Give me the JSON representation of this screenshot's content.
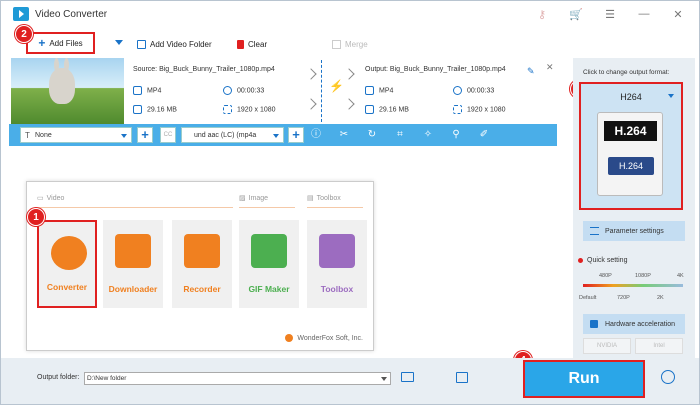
{
  "app": {
    "title": "Video Converter"
  },
  "toolbar": {
    "add_files": "Add Files",
    "add_folder": "Add Video Folder",
    "clear": "Clear",
    "merge": "Merge"
  },
  "file": {
    "source": "Source: Big_Buck_Bunny_Trailer_1080p.mp4",
    "output": "Output: Big_Buck_Bunny_Trailer_1080p.mp4",
    "src_format": "MP4",
    "src_duration": "00:00:33",
    "src_size": "29.16 MB",
    "src_res": "1920 x 1080",
    "out_format": "MP4",
    "out_duration": "00:00:33",
    "out_size": "29.16 MB",
    "out_res": "1920 x 1080"
  },
  "editbar": {
    "subtitle": "None",
    "audio": "und aac (LC) (mp4a",
    "cc": "CC"
  },
  "hub": {
    "sections": {
      "video": "Video",
      "image": "Image",
      "toolbox": "Toolbox"
    },
    "tiles": [
      {
        "label": "Converter",
        "color": "#f08020"
      },
      {
        "label": "Downloader",
        "color": "#f08020"
      },
      {
        "label": "Recorder",
        "color": "#f08020"
      },
      {
        "label": "GIF Maker",
        "color": "#4caf50"
      },
      {
        "label": "Toolbox",
        "color": "#9c6cc0"
      }
    ],
    "brand": "WonderFox Soft, Inc."
  },
  "right_panel": {
    "hint": "Click to change output format:",
    "format_name": "H264",
    "format_top": "H.264",
    "format_bottom": "H.264",
    "parameter_settings": "Parameter settings",
    "quick_setting": "Quick setting",
    "q_top": [
      "480P",
      "1080P",
      "4K"
    ],
    "q_bottom": [
      "Default",
      "720P",
      "2K"
    ],
    "hw_accel": "Hardware acceleration",
    "gpu": [
      "NVIDIA",
      "Intel"
    ]
  },
  "bottom": {
    "output_label": "Output folder:",
    "output_path": "D:\\New folder",
    "run": "Run"
  },
  "callouts": [
    "1",
    "2",
    "3",
    "4"
  ]
}
